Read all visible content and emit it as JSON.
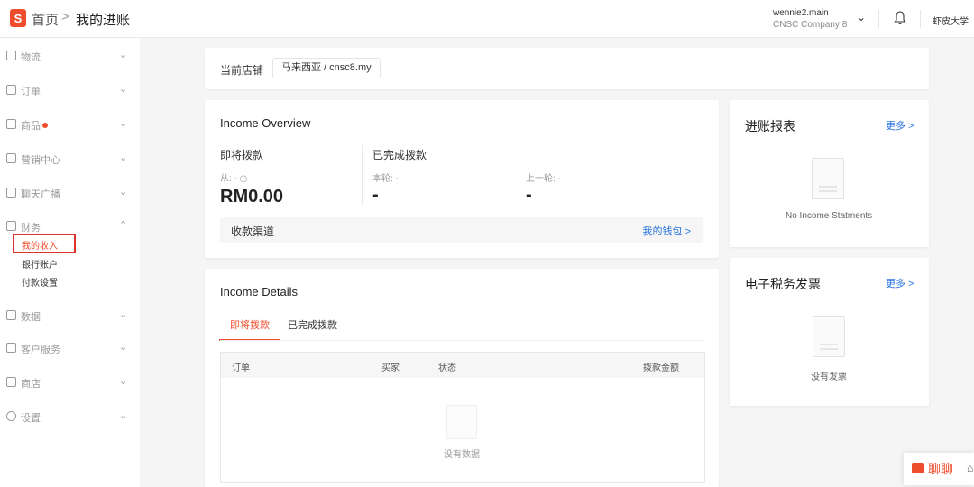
{
  "header": {
    "logo_letter": "S",
    "breadcrumb_home": "首页",
    "breadcrumb_sep": ">",
    "breadcrumb_current": "我的进账",
    "account_name": "wennie2.main",
    "account_company": "CNSC Company 8",
    "shopee_university": "虾皮大学"
  },
  "sidebar": {
    "items": [
      {
        "label": "物流"
      },
      {
        "label": "订单"
      },
      {
        "label": "商品"
      },
      {
        "label": "营销中心"
      },
      {
        "label": "聊天广播"
      },
      {
        "label": "财务"
      },
      {
        "label": "数据"
      },
      {
        "label": "客户服务"
      },
      {
        "label": "商店"
      },
      {
        "label": "设置"
      }
    ],
    "finance_sub": [
      "我的收入",
      "银行账户",
      "付款设置"
    ]
  },
  "shop": {
    "label": "当前店铺",
    "value": "马来西亚 / cnsc8.my"
  },
  "overview": {
    "title": "Income Overview",
    "pending_title": "即将拨款",
    "pending_from": "从: -",
    "pending_amount": "RM0.00",
    "released_title": "已完成拨款",
    "this_round": "本轮: -",
    "this_round_amount": "-",
    "last_round": "上一轮: -",
    "last_round_amount": "-",
    "channel_label": "收款渠道",
    "wallet_link": "我的钱包 >"
  },
  "income_report": {
    "title": "进账报表",
    "more": "更多 >",
    "empty": "No Income Statments"
  },
  "details": {
    "title": "Income Details",
    "tabs": [
      "即将拨款",
      "已完成拨款"
    ],
    "columns": [
      "订单",
      "买家",
      "状态",
      "拨款金额"
    ],
    "empty": "没有数据"
  },
  "tax_invoice": {
    "title": "电子税务发票",
    "more": "更多 >",
    "empty": "没有发票"
  },
  "chat": {
    "label": "聊聊"
  },
  "colors": {
    "brand": "#ee4d2d",
    "link": "#2673dd"
  }
}
